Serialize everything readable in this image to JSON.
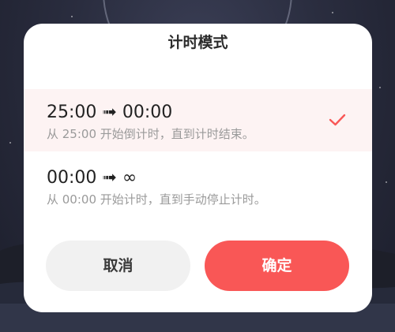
{
  "dialog": {
    "title": "计时模式",
    "options": [
      {
        "main": "25:00 ➟ 00:00",
        "sub": "从 25:00 开始倒计时，直到计时结束。",
        "selected": true
      },
      {
        "main": "00:00 ➟ ∞",
        "sub": "从 00:00 开始计时，直到手动停止计时。",
        "selected": false
      }
    ],
    "cancel_label": "取消",
    "confirm_label": "确定"
  },
  "colors": {
    "accent": "#f95756",
    "selected_bg": "#fdf3f3",
    "cancel_bg": "#f1f1f1"
  },
  "icons": {
    "selected_indicator": "checkmark-icon"
  }
}
